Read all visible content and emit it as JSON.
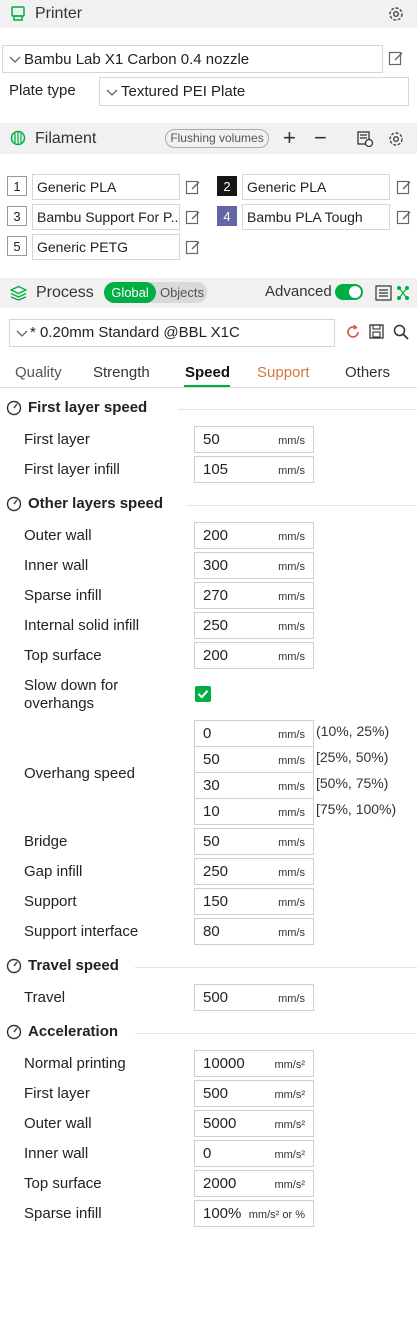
{
  "printer": {
    "title": "Printer",
    "preset": "Bambu Lab X1 Carbon 0.4 nozzle",
    "plate_label": "Plate type",
    "plate_value": "Textured PEI Plate"
  },
  "filament": {
    "title": "Filament",
    "flushing_label": "Flushing volumes",
    "plus": "+",
    "minus": "−",
    "items": [
      {
        "num": "1",
        "name": "Generic PLA",
        "swatch": "#ffffff"
      },
      {
        "num": "2",
        "name": "Generic PLA",
        "swatch": "#161616"
      },
      {
        "num": "3",
        "name": "Bambu Support For P...",
        "swatch": "#ffffff"
      },
      {
        "num": "4",
        "name": "Bambu PLA Tough",
        "swatch": "#6366a5"
      },
      {
        "num": "5",
        "name": "Generic PETG",
        "swatch": "#ffffff"
      }
    ]
  },
  "process": {
    "title": "Process",
    "global_label": "Global",
    "objects_label": "Objects",
    "advanced_label": "Advanced",
    "advanced_on": true,
    "preset": "* 0.20mm Standard @BBL X1C",
    "tabs": [
      "Quality",
      "Strength",
      "Speed",
      "Support",
      "Others"
    ],
    "active_tab": "Speed"
  },
  "sections": {
    "first_layer": {
      "title": "First layer speed",
      "rows": [
        {
          "label": "First layer",
          "value": "50",
          "unit": "mm/s"
        },
        {
          "label": "First layer infill",
          "value": "105",
          "unit": "mm/s"
        }
      ]
    },
    "other_layers": {
      "title": "Other layers speed",
      "rows": [
        {
          "label": "Outer wall",
          "value": "200",
          "unit": "mm/s"
        },
        {
          "label": "Inner wall",
          "value": "300",
          "unit": "mm/s"
        },
        {
          "label": "Sparse infill",
          "value": "270",
          "unit": "mm/s"
        },
        {
          "label": "Internal solid infill",
          "value": "250",
          "unit": "mm/s"
        },
        {
          "label": "Top surface",
          "value": "200",
          "unit": "mm/s"
        }
      ],
      "slow_down_label_1": "Slow down for",
      "slow_down_label_2": "overhangs",
      "slow_down_checked": true,
      "overhang_label": "Overhang speed",
      "overhang": [
        {
          "value": "0",
          "unit": "mm/s",
          "range": "(10%, 25%)"
        },
        {
          "value": "50",
          "unit": "mm/s",
          "range": "[25%, 50%)"
        },
        {
          "value": "30",
          "unit": "mm/s",
          "range": "[50%, 75%)"
        },
        {
          "value": "10",
          "unit": "mm/s",
          "range": "[75%, 100%)"
        }
      ],
      "rows2": [
        {
          "label": "Bridge",
          "value": "50",
          "unit": "mm/s"
        },
        {
          "label": "Gap infill",
          "value": "250",
          "unit": "mm/s"
        },
        {
          "label": "Support",
          "value": "150",
          "unit": "mm/s"
        },
        {
          "label": "Support interface",
          "value": "80",
          "unit": "mm/s"
        }
      ]
    },
    "travel": {
      "title": "Travel speed",
      "rows": [
        {
          "label": "Travel",
          "value": "500",
          "unit": "mm/s"
        }
      ]
    },
    "acceleration": {
      "title": "Acceleration",
      "rows": [
        {
          "label": "Normal printing",
          "value": "10000",
          "unit": "mm/s²"
        },
        {
          "label": "First layer",
          "value": "500",
          "unit": "mm/s²"
        },
        {
          "label": "Outer wall",
          "value": "5000",
          "unit": "mm/s²"
        },
        {
          "label": "Inner wall",
          "value": "0",
          "unit": "mm/s²"
        },
        {
          "label": "Top surface",
          "value": "2000",
          "unit": "mm/s²"
        },
        {
          "label": "Sparse infill",
          "value": "100%",
          "unit": "mm/s² or %"
        }
      ]
    }
  },
  "colors": {
    "accent": "#00ae42",
    "support_tab": "#d4773a",
    "header_bg": "#f1f1f1"
  }
}
